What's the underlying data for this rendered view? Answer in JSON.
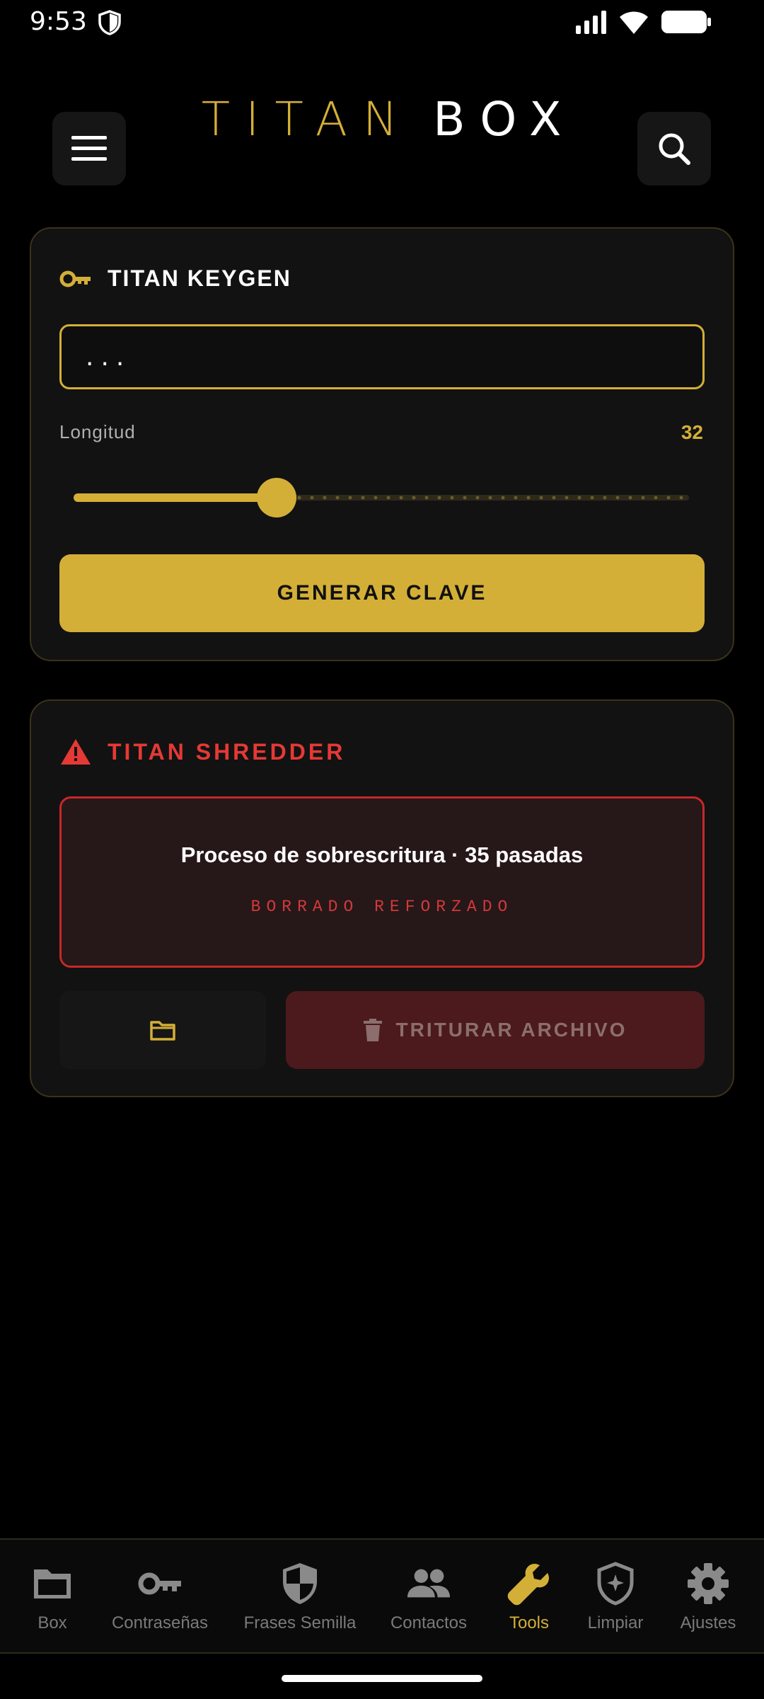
{
  "status_bar": {
    "time": "9:53"
  },
  "header": {
    "logo_primary": "TITAN",
    "logo_secondary": "BOX"
  },
  "keygen": {
    "title": "TITAN KEYGEN",
    "password_value": "...",
    "length_label": "Longitud",
    "length_value": "32",
    "slider_fraction": 0.33,
    "generate_label": "GENERAR CLAVE"
  },
  "shredder": {
    "title": "TITAN SHREDDER",
    "process_text": "Proceso de sobrescritura · 35 pasadas",
    "subtitle": "BORRADO REFORZADO",
    "shred_label": "TRITURAR ARCHIVO"
  },
  "nav": {
    "items": [
      {
        "label": "Box",
        "icon": "folder-icon"
      },
      {
        "label": "Contraseñas",
        "icon": "key-icon"
      },
      {
        "label": "Frases Semilla",
        "icon": "shield-icon"
      },
      {
        "label": "Contactos",
        "icon": "people-icon"
      },
      {
        "label": "Tools",
        "icon": "wrench-icon"
      },
      {
        "label": "Limpiar",
        "icon": "shield-star-icon"
      },
      {
        "label": "Ajustes",
        "icon": "gear-icon"
      }
    ],
    "active_index": 4
  },
  "colors": {
    "accent": "#d4af37",
    "danger": "#e53935",
    "background": "#000000",
    "card": "#121212"
  }
}
